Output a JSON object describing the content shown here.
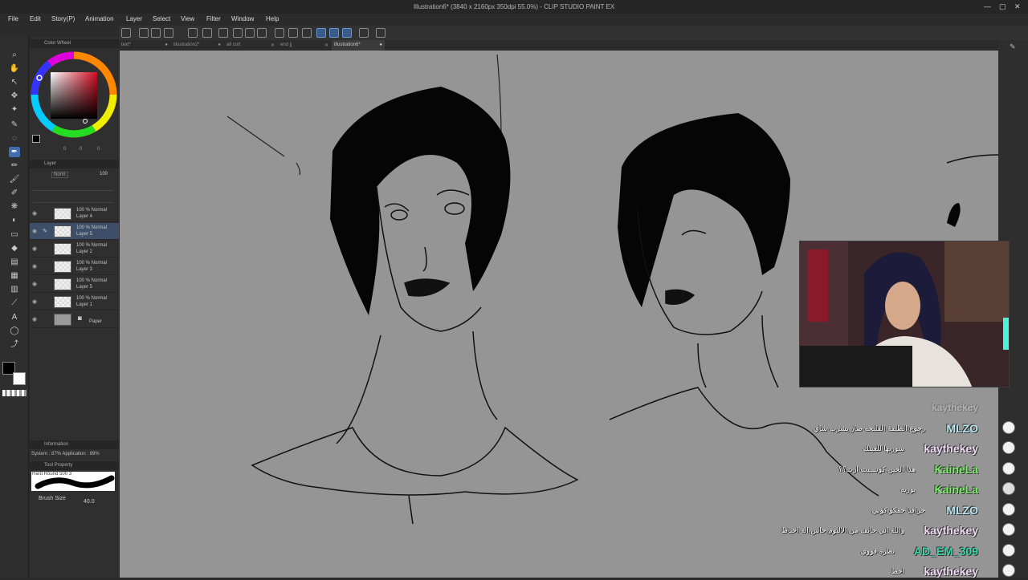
{
  "window": {
    "title": "Illustration6* (3840 x 2160px 350dpi 55.0%) - CLIP STUDIO PAINT EX"
  },
  "menu": [
    "File",
    "Edit",
    "Story(P)",
    "Animation",
    "Layer",
    "Select",
    "View",
    "Filter",
    "Window",
    "Help"
  ],
  "tabs": [
    {
      "label": "text*",
      "active": false
    },
    {
      "label": "illustration2*",
      "active": false
    },
    {
      "label": "all cort",
      "active": false
    },
    {
      "label": "end jj",
      "active": false
    },
    {
      "label": "illustration6*",
      "active": true
    }
  ],
  "color_wheel": {
    "title": "Color Wheel",
    "values": [
      "0",
      "0",
      "0"
    ]
  },
  "layer_panel": {
    "title": "Layer",
    "blend": "Norm",
    "opacity": "100",
    "layers": [
      {
        "mode": "100 % Normal",
        "name": "Layer 4",
        "active": false
      },
      {
        "mode": "100 % Normal",
        "name": "Layer 5",
        "active": true
      },
      {
        "mode": "100 % Normal",
        "name": "Layer 2",
        "active": false
      },
      {
        "mode": "100 % Normal",
        "name": "Layer 3",
        "active": false
      },
      {
        "mode": "100 % Normal",
        "name": "Layer 5",
        "active": false
      },
      {
        "mode": "100 % Normal",
        "name": "Layer 1",
        "active": false
      }
    ],
    "paper_label": "Paper"
  },
  "information": {
    "title": "Information",
    "text": "System : 87% Application : 89%"
  },
  "tool_property": {
    "title": "Tool Property",
    "brush_name": "Hard Round 500 3",
    "brush_size_label": "Brush Size",
    "brush_size_value": "40.0"
  },
  "colors": {
    "main": "#000000",
    "sub": "#ffffff",
    "accent": "#3f6db0"
  },
  "chat": {
    "faded_header": "kaythekey",
    "messages": [
      {
        "name": "MLZO",
        "color": "#b8e6f0",
        "text": "رجوع الظيفة القلبحه صار يشرب شاي"
      },
      {
        "name": "kaythekey",
        "color": "#f0d8f5",
        "text": "سوريها للعينك"
      },
      {
        "name": "KaineLa",
        "color": "#7cf06a",
        "text": "هذا الحين كونسبت ارت؟؟"
      },
      {
        "name": "KaineLa",
        "color": "#7cf06a",
        "text": "بوريه"
      },
      {
        "name": "MLZO",
        "color": "#b8e6f0",
        "text": "جرافيا جفكو كوبي"
      },
      {
        "name": "kaythekey",
        "color": "#f0d8f5",
        "text": "والله اني خايف من الالبوم حاس انه احباط"
      },
      {
        "name": "AD_EM_309",
        "color": "#3ad6a8",
        "text": "نظرة قووي"
      },
      {
        "name": "kaythekey",
        "color": "#f0d8f5",
        "text": "احظ"
      }
    ]
  }
}
